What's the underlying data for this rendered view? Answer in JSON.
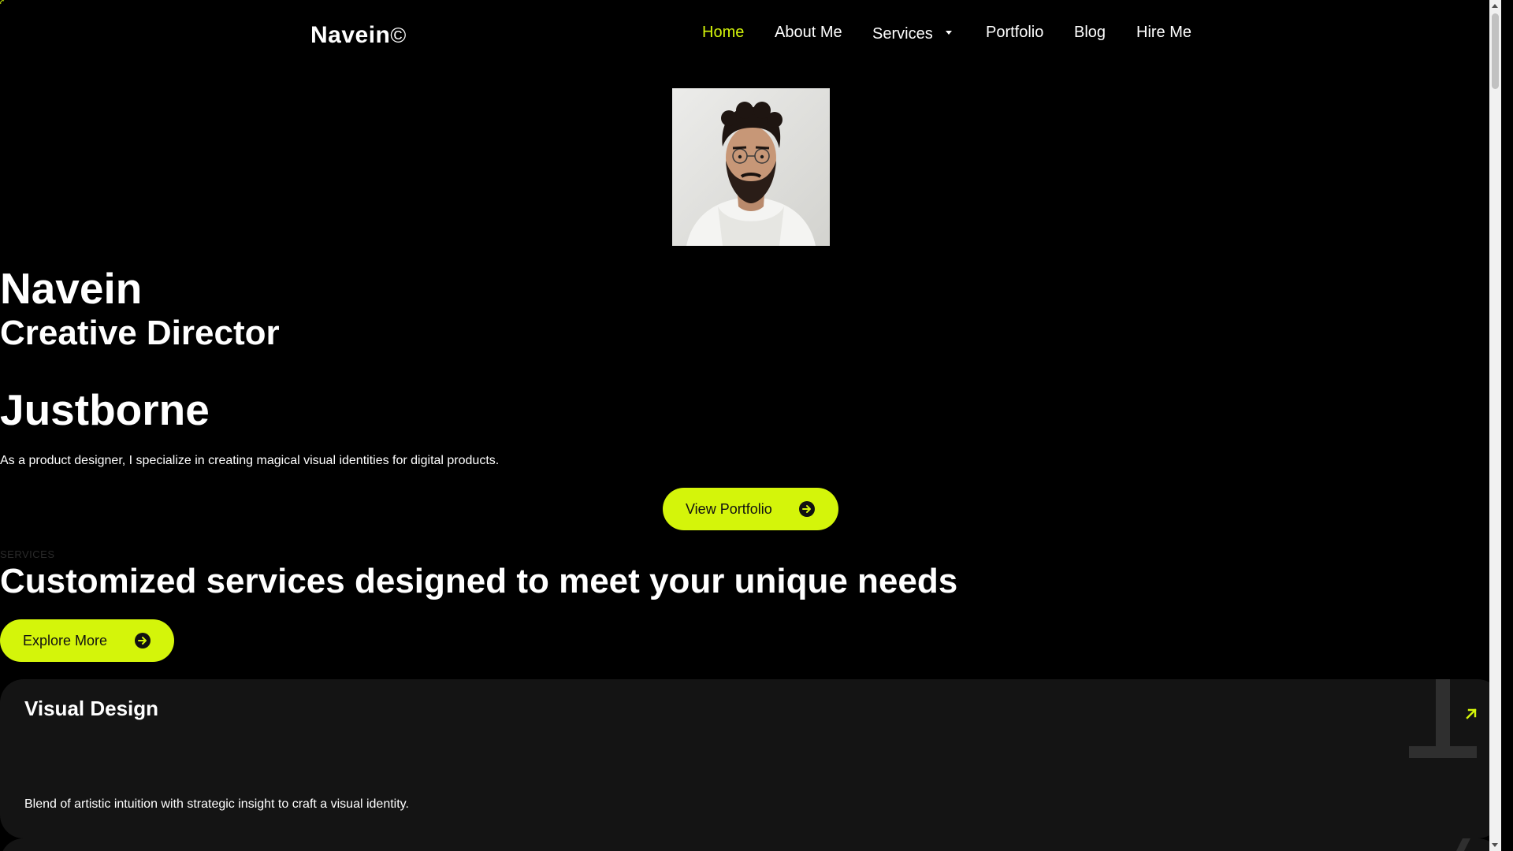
{
  "brand": {
    "logo_text": "Navein",
    "logo_mark": "©"
  },
  "nav": {
    "items": [
      {
        "label": "Home",
        "active": true
      },
      {
        "label": "About Me",
        "active": false
      },
      {
        "label": "Services",
        "active": false,
        "has_dropdown": true
      },
      {
        "label": "Portfolio",
        "active": false
      },
      {
        "label": "Blog",
        "active": false
      },
      {
        "label": "Hire Me",
        "active": false
      }
    ]
  },
  "hero": {
    "name": "Navein",
    "role": "Creative Director",
    "brand": "Justborne",
    "description": "As a product designer, I specialize in creating magical visual identities for digital products.",
    "cta_label": "View Portfolio",
    "cta_icon": "arrow-right-circle-icon"
  },
  "services": {
    "label": "SERVICES",
    "title": "Customized services designed to meet your unique needs",
    "cta_label": "Explore More",
    "cta_icon": "arrow-right-circle-icon",
    "cards": [
      {
        "title": "Visual Design",
        "description": "Blend of artistic intuition with strategic insight to craft a visual identity.",
        "icon": "arrow-up-right-icon"
      }
    ]
  },
  "colors": {
    "accent": "#d4f50a",
    "background": "#000000",
    "card": "#141414",
    "text": "#ffffff"
  }
}
